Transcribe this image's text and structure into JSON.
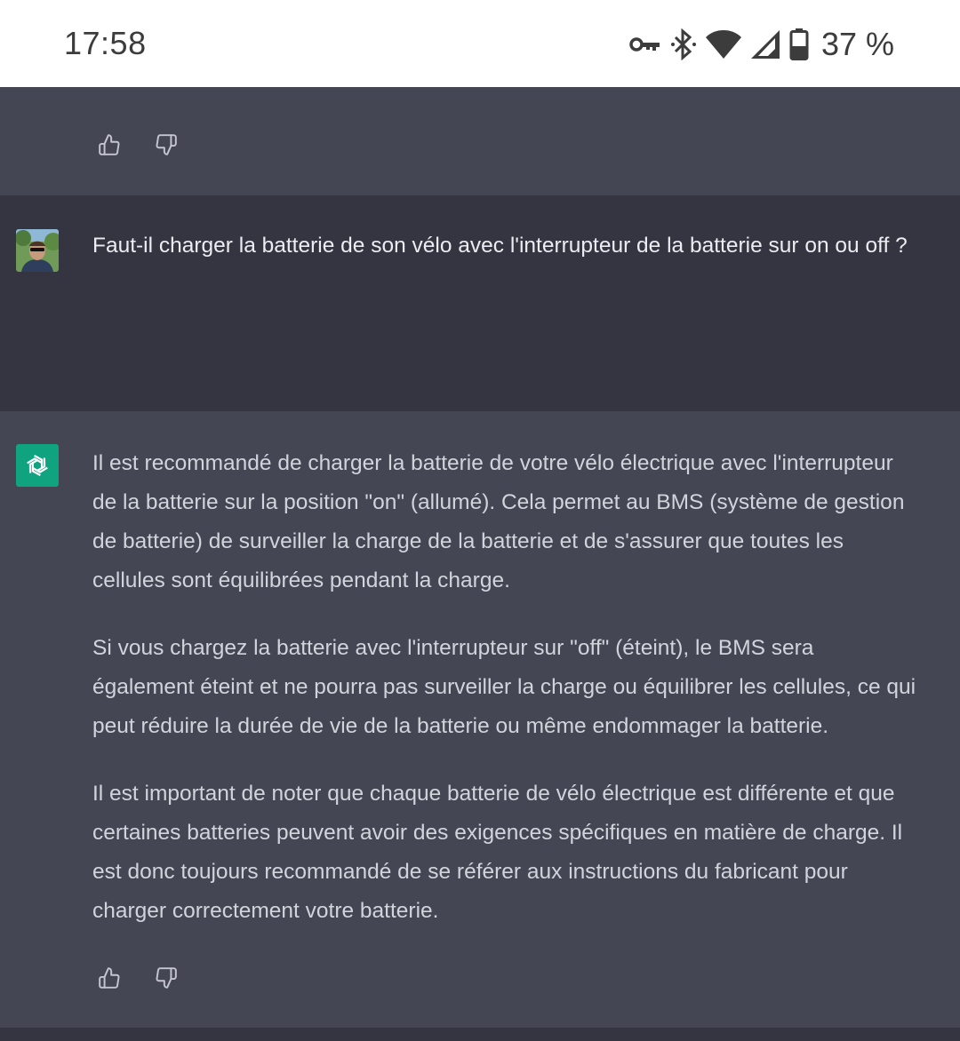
{
  "status_bar": {
    "time": "17:58",
    "battery_percent": "37 %",
    "icons": [
      "vpn-key-icon",
      "bluetooth-icon",
      "wifi-icon",
      "cell-signal-icon",
      "battery-icon"
    ]
  },
  "previous_message": {
    "feedback": [
      "thumbs-up-icon",
      "thumbs-down-icon"
    ]
  },
  "user_message": {
    "text": "Faut-il charger la batterie de son vélo avec l'interrupteur de la batterie sur on ou off ?"
  },
  "assistant_message": {
    "paragraphs": [
      "Il est recommandé de charger la batterie de votre vélo électrique avec l'interrupteur de la batterie sur la position \"on\" (allumé). Cela permet au BMS (système de gestion de batterie) de surveiller la charge de la batterie et de s'assurer que toutes les cellules sont équilibrées pendant la charge.",
      "Si vous chargez la batterie avec l'interrupteur sur \"off\" (éteint), le BMS sera également éteint et ne pourra pas surveiller la charge ou équilibrer les cellules, ce qui peut réduire la durée de vie de la batterie ou même endommager la batterie.",
      "Il est important de noter que chaque batterie de vélo électrique est différente et que certaines batteries peuvent avoir des exigences spécifiques en matière de charge. Il est donc toujours recommandé de se référer aux instructions du fabricant pour charger correctement votre batterie."
    ],
    "feedback": [
      "thumbs-up-icon",
      "thumbs-down-icon"
    ]
  },
  "colors": {
    "assistant_bg": "#444654",
    "user_bg": "#343541",
    "logo_green": "#10a37f",
    "text_user": "#ececf1",
    "text_assistant": "#d1d5db"
  }
}
